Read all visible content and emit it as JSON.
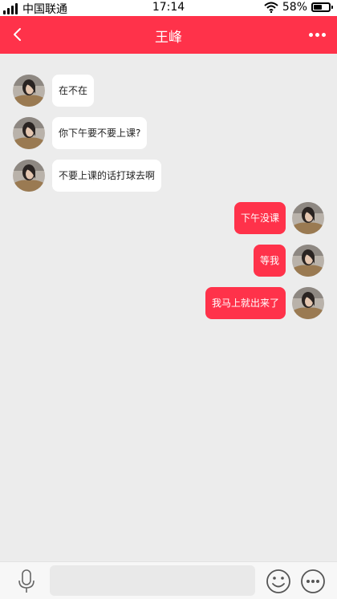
{
  "status_bar": {
    "carrier": "中国联通",
    "time": "17:14",
    "battery_percent": "58%",
    "battery_level": 0.58
  },
  "header": {
    "title": "王峰",
    "accent_color": "#ff324a"
  },
  "messages": [
    {
      "direction": "in",
      "text": "在不在"
    },
    {
      "direction": "in",
      "text": "你下午要不要上课?"
    },
    {
      "direction": "in",
      "text": "不要上课的话打球去啊"
    },
    {
      "direction": "out",
      "text": "下午没课"
    },
    {
      "direction": "out",
      "text": "等我"
    },
    {
      "direction": "out",
      "text": "我马上就出来了"
    }
  ],
  "bottom_bar": {
    "input_value": "",
    "icons": [
      "microphone-icon",
      "emoji-icon",
      "more-options-icon"
    ]
  }
}
